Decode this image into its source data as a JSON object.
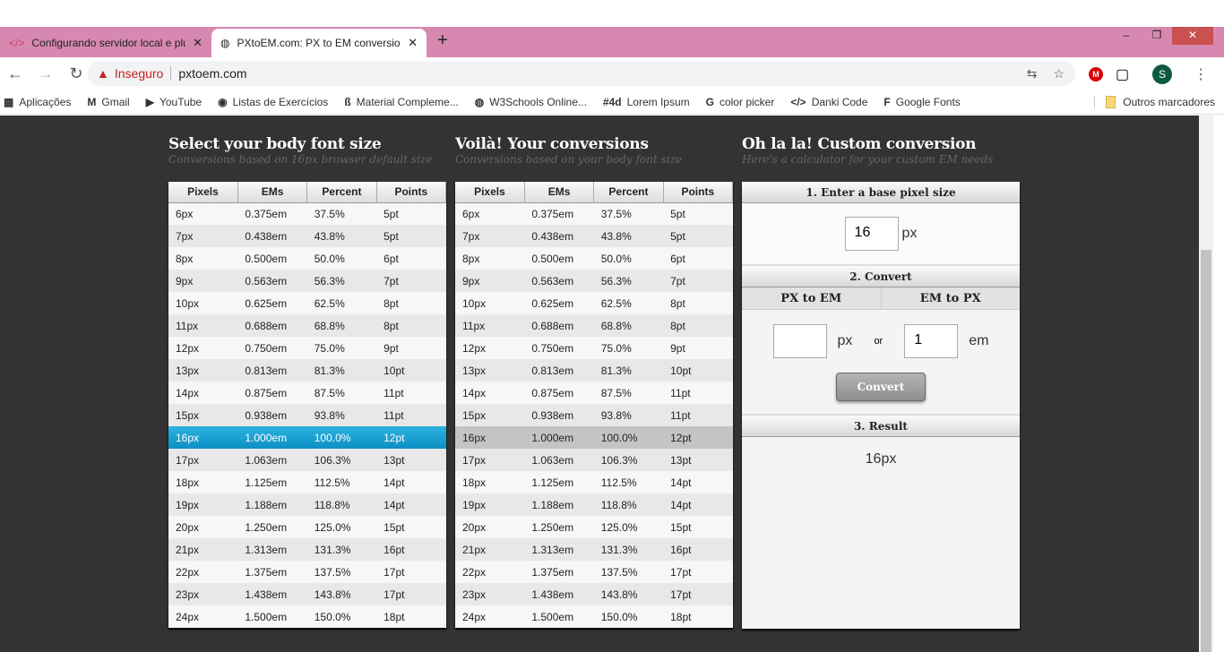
{
  "browser": {
    "tabs": [
      {
        "title": "Configurando servidor local e plu",
        "icon": "code-icon"
      },
      {
        "title": "PXtoEM.com: PX to EM conversio",
        "icon": "globe-icon"
      }
    ],
    "security": "Inseguro",
    "url": "pxtoem.com",
    "avatar": "S",
    "mega": "M",
    "bookmarks": [
      {
        "label": "Aplicações",
        "icon": "▦"
      },
      {
        "label": "Gmail",
        "icon": "M"
      },
      {
        "label": "YouTube",
        "icon": "▶"
      },
      {
        "label": "Listas de Exercícios",
        "icon": "◉"
      },
      {
        "label": "Material Compleme...",
        "icon": "ß"
      },
      {
        "label": "W3Schools Online...",
        "icon": "◍"
      },
      {
        "label": "Lorem Ipsum",
        "icon": "#4d"
      },
      {
        "label": "color picker",
        "icon": "G"
      },
      {
        "label": "Danki Code",
        "icon": "</>"
      },
      {
        "label": "Google Fonts",
        "icon": "F"
      }
    ],
    "other_bookmarks": "Outros marcadores"
  },
  "sections": [
    {
      "title": "Select your body font size",
      "subtitle": "Conversions based on 16px browser default size"
    },
    {
      "title": "Voilà! Your conversions",
      "subtitle": "Conversions based on your body font size"
    },
    {
      "title": "Oh la la! Custom conversion",
      "subtitle": "Here's a calculator for your custom EM needs"
    }
  ],
  "table": {
    "headers": [
      "Pixels",
      "EMs",
      "Percent",
      "Points"
    ],
    "selected": "16px",
    "rows": [
      [
        "6px",
        "0.375em",
        "37.5%",
        "5pt"
      ],
      [
        "7px",
        "0.438em",
        "43.8%",
        "5pt"
      ],
      [
        "8px",
        "0.500em",
        "50.0%",
        "6pt"
      ],
      [
        "9px",
        "0.563em",
        "56.3%",
        "7pt"
      ],
      [
        "10px",
        "0.625em",
        "62.5%",
        "8pt"
      ],
      [
        "11px",
        "0.688em",
        "68.8%",
        "8pt"
      ],
      [
        "12px",
        "0.750em",
        "75.0%",
        "9pt"
      ],
      [
        "13px",
        "0.813em",
        "81.3%",
        "10pt"
      ],
      [
        "14px",
        "0.875em",
        "87.5%",
        "11pt"
      ],
      [
        "15px",
        "0.938em",
        "93.8%",
        "11pt"
      ],
      [
        "16px",
        "1.000em",
        "100.0%",
        "12pt"
      ],
      [
        "17px",
        "1.063em",
        "106.3%",
        "13pt"
      ],
      [
        "18px",
        "1.125em",
        "112.5%",
        "14pt"
      ],
      [
        "19px",
        "1.188em",
        "118.8%",
        "14pt"
      ],
      [
        "20px",
        "1.250em",
        "125.0%",
        "15pt"
      ],
      [
        "21px",
        "1.313em",
        "131.3%",
        "16pt"
      ],
      [
        "22px",
        "1.375em",
        "137.5%",
        "17pt"
      ],
      [
        "23px",
        "1.438em",
        "143.8%",
        "17pt"
      ],
      [
        "24px",
        "1.500em",
        "150.0%",
        "18pt"
      ]
    ]
  },
  "calculator": {
    "step1": "1. Enter a base pixel size",
    "base_value": "16",
    "px_unit": "px",
    "step2": "2. Convert",
    "px_to_em": "PX to EM",
    "em_to_px": "EM to PX",
    "px_value": "",
    "em_value": "1",
    "or": "or",
    "em_unit": "em",
    "convert": "Convert",
    "step3": "3. Result",
    "result": "16px"
  }
}
